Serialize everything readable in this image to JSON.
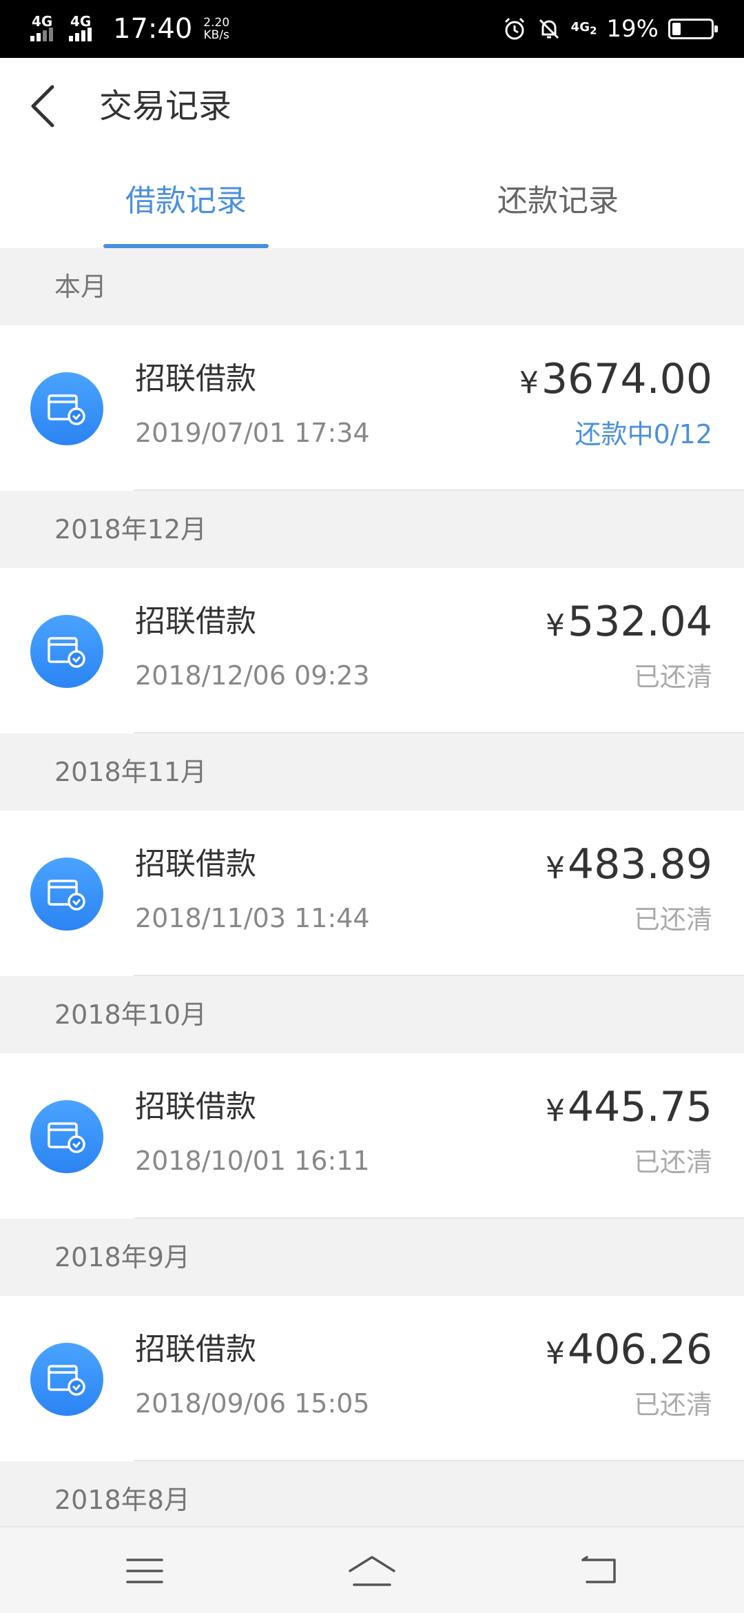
{
  "status_bar": {
    "signal1": "4G",
    "signal2": "4G",
    "time": "17:40",
    "speed_value": "2.20",
    "speed_unit": "KB/s",
    "network": "4G",
    "network_sub": "2",
    "battery_percent": "19%"
  },
  "header": {
    "title": "交易记录"
  },
  "tabs": [
    {
      "label": "借款记录",
      "active": true
    },
    {
      "label": "还款记录",
      "active": false
    }
  ],
  "sections": [
    {
      "label": "本月",
      "items": [
        {
          "name": "招联借款",
          "date": "2019/07/01 17:34",
          "amount": "3674.00",
          "status": "还款中0/12"
        }
      ]
    },
    {
      "label": "2018年12月",
      "items": [
        {
          "name": "招联借款",
          "date": "2018/12/06 09:23",
          "amount": "532.04",
          "status": "已还清"
        }
      ]
    },
    {
      "label": "2018年11月",
      "items": [
        {
          "name": "招联借款",
          "date": "2018/11/03 11:44",
          "amount": "483.89",
          "status": "已还清"
        }
      ]
    },
    {
      "label": "2018年10月",
      "items": [
        {
          "name": "招联借款",
          "date": "2018/10/01 16:11",
          "amount": "445.75",
          "status": "已还清"
        }
      ]
    },
    {
      "label": "2018年9月",
      "items": [
        {
          "name": "招联借款",
          "date": "2018/09/06 15:05",
          "amount": "406.26",
          "status": "已还清"
        }
      ]
    },
    {
      "label": "2018年8月",
      "items": []
    }
  ],
  "currency_symbol": "¥",
  "colors": {
    "accent": "#4a8fe0",
    "icon_blue": "#2b84f3",
    "section_bg": "#f2f2f2"
  }
}
